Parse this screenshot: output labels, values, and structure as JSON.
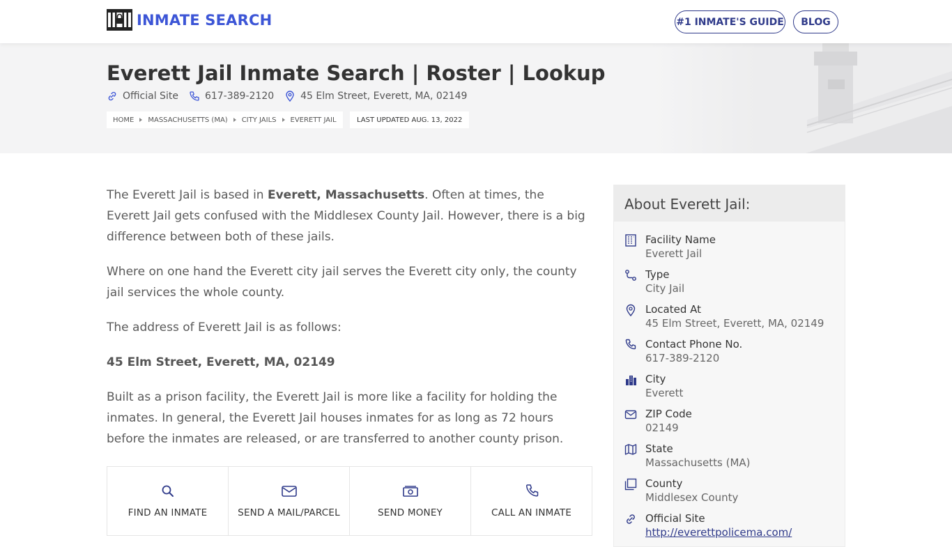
{
  "header": {
    "logo_text": "INMATE SEARCH",
    "nav": {
      "guide_label": "#1 INMATE'S GUIDE",
      "blog_label": "BLOG"
    }
  },
  "hero": {
    "title": "Everett Jail Inmate Search | Roster | Lookup",
    "meta": {
      "official_site": "Official Site",
      "phone": "617-389-2120",
      "address": "45 Elm Street, Everett, MA, 02149"
    },
    "breadcrumb": [
      "HOME",
      "MASSACHUSETTS (MA)",
      "CITY JAILS",
      "EVERETT JAIL"
    ],
    "last_updated": "LAST UPDATED AUG. 13, 2022"
  },
  "content": {
    "p1_a": "The Everett Jail is based in ",
    "p1_bold": "Everett, Massachusetts",
    "p1_b": ". Often at times, the Everett Jail gets confused with the Middlesex County Jail. However, there is a big difference between both of these jails.",
    "p2": "Where on one hand the Everett city jail serves the Everett city only, the county jail services the whole county.",
    "p3": "The address of Everett Jail is as follows:",
    "p4_bold": "45 Elm Street, Everett, MA, 02149",
    "p5": "Built as a prison facility, the Everett Jail is more like a facility for holding the inmates. In general, the Everett Jail houses inmates for as long as 72 hours before the inmates are released, or are transferred to another county prison."
  },
  "actions": [
    {
      "label": "FIND AN INMATE",
      "icon": "search-icon"
    },
    {
      "label": "SEND A MAIL/PARCEL",
      "icon": "mail-icon"
    },
    {
      "label": "SEND MONEY",
      "icon": "money-icon"
    },
    {
      "label": "CALL AN INMATE",
      "icon": "phone-icon"
    }
  ],
  "sidebar": {
    "title": "About Everett Jail:",
    "items": [
      {
        "label": "Facility Name",
        "value": "Everett Jail",
        "icon": "building-icon"
      },
      {
        "label": "Type",
        "value": "City Jail",
        "icon": "route-icon"
      },
      {
        "label": "Located At",
        "value": "45 Elm Street, Everett, MA, 02149",
        "icon": "location-pin-icon"
      },
      {
        "label": "Contact Phone No.",
        "value": "617-389-2120",
        "icon": "phone-icon"
      },
      {
        "label": "City",
        "value": "Everett",
        "icon": "city-icon"
      },
      {
        "label": "ZIP Code",
        "value": "02149",
        "icon": "envelope-icon"
      },
      {
        "label": "State",
        "value": "Massachusetts (MA)",
        "icon": "map-icon"
      },
      {
        "label": "County",
        "value": "Middlesex County",
        "icon": "copy-icon"
      },
      {
        "label": "Official Site",
        "value": "http://everettpolicema.com/",
        "icon": "link-icon"
      }
    ]
  },
  "colors": {
    "brand_blue": "#3c55d6",
    "nav_border": "#2f3a8a",
    "hero_bg": "#f4f4f5",
    "sidebar_bg": "#f7f7f7"
  }
}
